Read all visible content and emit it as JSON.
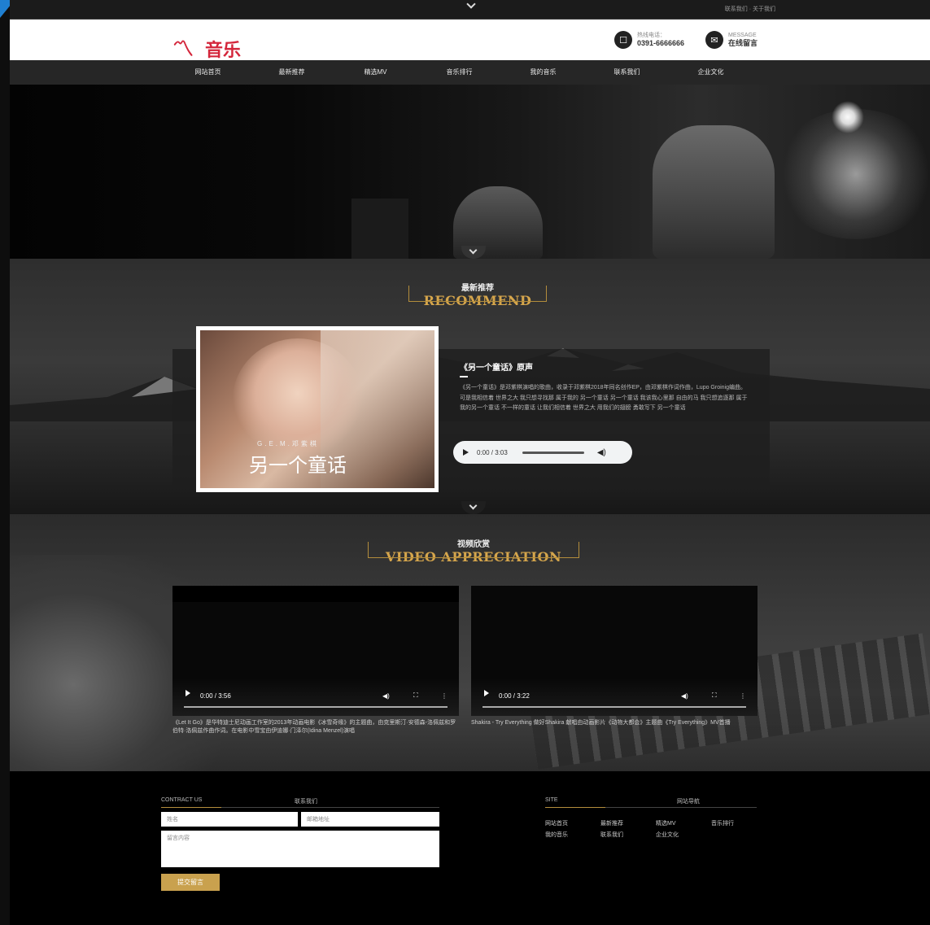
{
  "topbar": {
    "links": "联系我们 · 关于我们"
  },
  "header": {
    "logo_text": "音乐",
    "phone": {
      "label": "热线电话：",
      "value": "0391-6666666"
    },
    "message": {
      "label": "MESSAGE",
      "value": "在线留言"
    }
  },
  "nav": {
    "items": [
      {
        "label": "网站首页"
      },
      {
        "label": "最新推荐"
      },
      {
        "label": "精选MV"
      },
      {
        "label": "音乐排行"
      },
      {
        "label": "我的音乐"
      },
      {
        "label": "联系我们"
      },
      {
        "label": "企业文化"
      }
    ]
  },
  "recommend": {
    "title_cn": "最新推荐",
    "title_en": "RECOMMEND",
    "album": {
      "artist": "G.E.M.邓紫棋",
      "album_name": "另一个童话"
    },
    "song_title": "《另一个童话》原声",
    "description": "《另一个童话》是邓紫棋演唱的歌曲，收录于邓紫棋2018年同名创作EP，由邓紫棋作词作曲，Lupo Groinig编曲。可是我相信着 世界之大 我只想寻找那 属于我的 另一个童话 另一个童话 我该我心里那 自由的马 我只想追逐那 属于我的另一个童话 不一样的童话 让我们相信着 世界之大 用我们的翅膀 勇敢写下 另一个童话",
    "audio_time": "0:00 / 3:03"
  },
  "video": {
    "title_cn": "视频欣赏",
    "title_en": "VIDEO APPRECIATION",
    "players": [
      {
        "time": "0:00 / 3:56",
        "desc": "《Let It Go》是华特迪士尼动画工作室的2013年动画电影《冰雪奇缘》的主题曲，由克里斯汀·安德森-洛佩兹和罗伯特·洛佩兹作曲作词。在电影中雪宝由伊迪娜·门泽尔(Idina Menzel)演唱"
      },
      {
        "time": "0:00 / 3:22",
        "desc": "Shakira - Try Everything 做好Shakira 献唱由动画影片《动物大都会》主题曲《Try Everything》MV首播"
      }
    ]
  },
  "footer": {
    "contact_en": "CONTRACT US",
    "contact_cn": "联系我们",
    "name_placeholder": "姓名",
    "email_placeholder": "邮箱地址",
    "message_placeholder": "留言内容",
    "submit_label": "提交留言",
    "site_en": "SITE",
    "site_cn": "网站导航",
    "site_links": [
      {
        "label": "网站首页"
      },
      {
        "label": "最新推荐"
      },
      {
        "label": "精选MV"
      },
      {
        "label": "音乐排行"
      },
      {
        "label": "我的音乐"
      },
      {
        "label": "联系我们"
      },
      {
        "label": "企业文化"
      }
    ]
  },
  "colors": {
    "accent_gold": "#d6a64c",
    "logo_red": "#d4263b",
    "nav_bg": "#262626"
  },
  "icons": {
    "phone": "phone-icon",
    "message": "message-icon",
    "chevron": "chevron-down-icon"
  }
}
